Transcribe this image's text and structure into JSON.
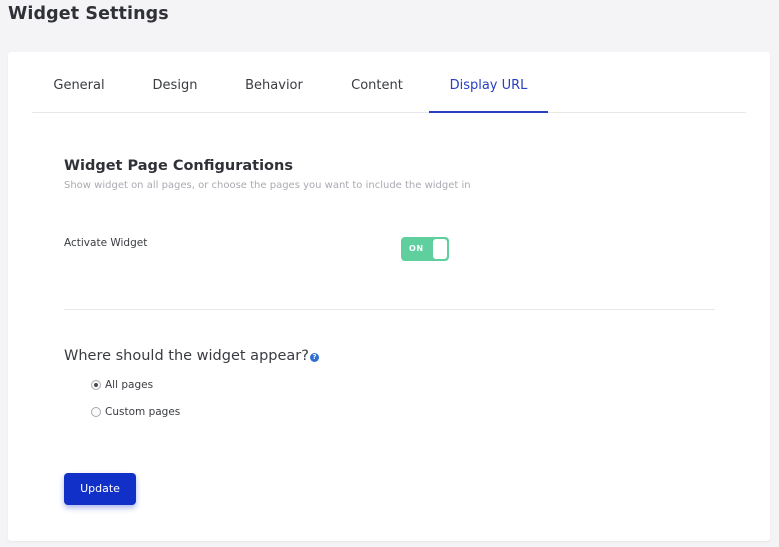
{
  "page": {
    "title": "Widget Settings"
  },
  "tabs": [
    {
      "label": "General",
      "active": false
    },
    {
      "label": "Design",
      "active": false
    },
    {
      "label": "Behavior",
      "active": false
    },
    {
      "label": "Content",
      "active": false
    },
    {
      "label": "Display URL",
      "active": true
    }
  ],
  "section": {
    "title": "Widget Page Configurations",
    "subtitle": "Show widget on all pages, or choose the pages you want to include the widget in"
  },
  "activate": {
    "label": "Activate Widget",
    "toggle_text": "ON",
    "enabled": true
  },
  "placement": {
    "question": "Where should the widget appear?",
    "help_icon": "question-circle-icon",
    "help_glyph": "?",
    "options": [
      {
        "label": "All pages",
        "selected": true
      },
      {
        "label": "Custom pages",
        "selected": false
      }
    ]
  },
  "actions": {
    "update_label": "Update"
  },
  "colors": {
    "accent": "#2740c4",
    "button": "#1130c8",
    "toggle_on": "#5fcf9d"
  }
}
